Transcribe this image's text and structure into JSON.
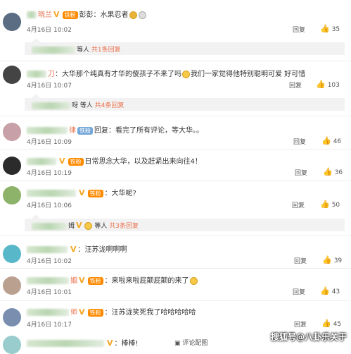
{
  "comments": [
    {
      "name": "晓兰",
      "text": "彭彭：水果忍者",
      "time": "4月16日 10:02",
      "reply": "回复",
      "likes": "35"
    },
    {
      "name": "刀",
      "text": "大华那个纯真有才华的傻孩子不来了吗",
      "text2": "我们一家觉得他特别聪明可爱 好可惜",
      "time": "4月16日 10:07",
      "reply": "回复",
      "likes": "103"
    },
    {
      "name": "律",
      "badge": "铁粉",
      "text": "回复：看完了所有评论，等大华。。",
      "time": "4月16日 10:09",
      "reply": "回复",
      "likes": "46"
    },
    {
      "name": "",
      "text": "日常思念大华，以及赶紧出来向往4！",
      "time": "4月16日 10:19",
      "reply": "回复",
      "likes": "36"
    },
    {
      "name": "",
      "text": "：大华呢?",
      "time": "4月16日 10:06",
      "reply": "回复",
      "likes": "50"
    },
    {
      "name": "",
      "text": "汪苏泷啊啊啊",
      "time": "4月16日 10:02",
      "reply": "回复",
      "likes": "39"
    },
    {
      "name": "姻",
      "text": "来啦来啦屁颠屁颠的来了",
      "time": "4月16日 10:01",
      "reply": "回复",
      "likes": "43"
    },
    {
      "name": "师",
      "text": "汪苏泷笑死我了哈哈哈哈哈",
      "time": "4月16日 10:17",
      "reply": "回复",
      "likes": "45"
    },
    {
      "name": "",
      "text": "棒棒!",
      "action": "评论配图"
    }
  ],
  "subreplies": [
    {
      "name": "",
      "text": "等人",
      "link": "共1条回复"
    },
    {
      "name": "呀",
      "text": "等人",
      "link": "共4条回复"
    },
    {
      "name": "姆",
      "text": "等人",
      "link": "共3条回复"
    }
  ],
  "badges": {
    "fan": "铁粉",
    "vip": "V"
  },
  "watermark": "搜狐号@八卦乐关于"
}
